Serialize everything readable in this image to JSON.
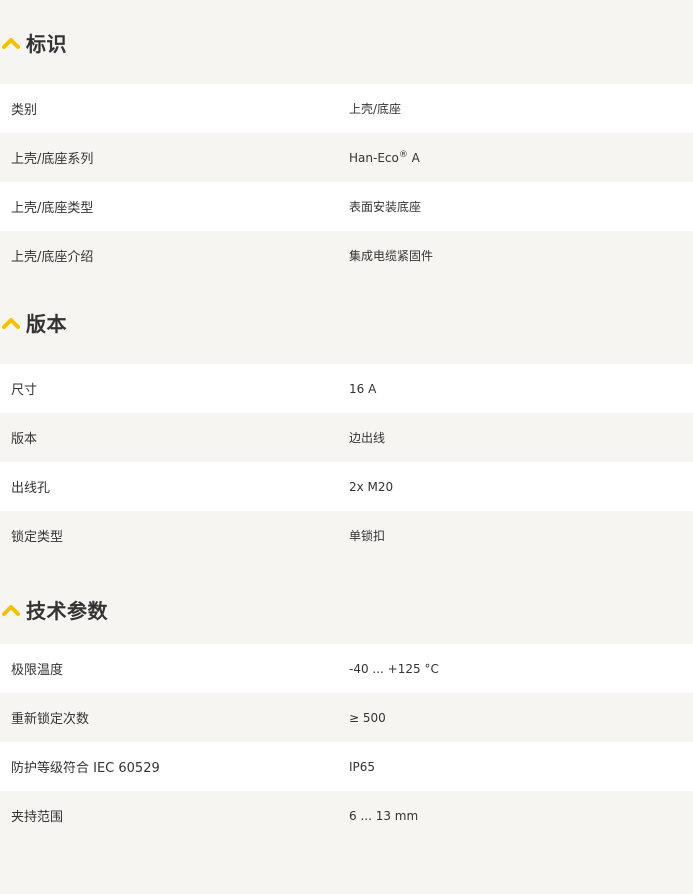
{
  "sections": [
    {
      "title": "标识",
      "rows": [
        {
          "label": "类别",
          "value": "上壳/底座"
        },
        {
          "label": "上壳/底座系列",
          "value": "Han-Eco",
          "value_sup": "®",
          "value_suffix": " A"
        },
        {
          "label": "上壳/底座类型",
          "value": "表面安装底座"
        },
        {
          "label": "上壳/底座介绍",
          "value": "集成电缆紧固件"
        }
      ]
    },
    {
      "title": "版本",
      "rows": [
        {
          "label": "尺寸",
          "value": "16 A"
        },
        {
          "label": "版本",
          "value": "边出线"
        },
        {
          "label": "出线孔",
          "value": "2x M20"
        },
        {
          "label": "锁定类型",
          "value": "单锁扣"
        }
      ]
    },
    {
      "title": "技术参数",
      "rows": [
        {
          "label": "极限温度",
          "value": "-40 ... +125 °C"
        },
        {
          "label": "重新锁定次数",
          "value": "≥ 500"
        },
        {
          "label": "防护等级符合 IEC 60529",
          "value": "IP65"
        },
        {
          "label": "夹持范围",
          "value": "6 ... 13 mm"
        }
      ]
    }
  ],
  "colors": {
    "accent": "#f2c200",
    "background": "#f6f5f2",
    "row_white": "#ffffff",
    "text": "#333333"
  },
  "icons": {
    "section_toggle": "chevron-up-icon"
  }
}
